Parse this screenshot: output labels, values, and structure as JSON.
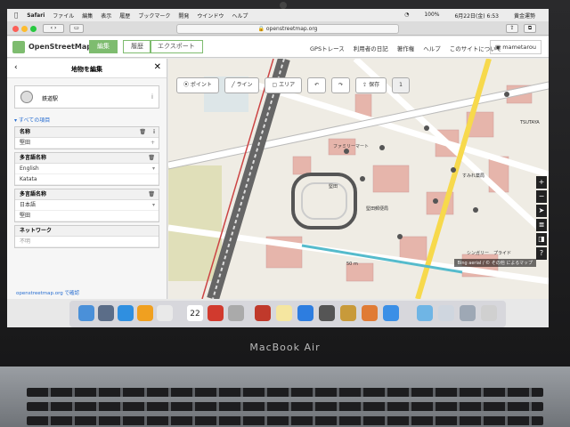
{
  "menubar": {
    "items": [
      "Safari",
      "ファイル",
      "編集",
      "表示",
      "履歴",
      "ブックマーク",
      "開発",
      "ウインドウ",
      "ヘルプ"
    ],
    "battery": "100%",
    "date": "6月22日(金) 6:53",
    "user": "黄金運勢"
  },
  "browser": {
    "url": "openstreetmap.org"
  },
  "osm": {
    "brand": "OpenStreetMap",
    "edit_label": "編集",
    "history_label": "履歴",
    "export_label": "エクスポート",
    "nav": [
      "GPSトレース",
      "利用者の日記",
      "著作権",
      "ヘルプ",
      "このサイトについて"
    ],
    "username": "mametarou"
  },
  "sidebar": {
    "title": "地物を編集",
    "preset_name": "鉄道駅",
    "all_fields": "すべての項目",
    "name_label": "名称",
    "name_value": "堅田",
    "multi_label": "多言語名称",
    "multi1_lang": "English",
    "multi1_value": "Katata",
    "multi2_lang": "日本語",
    "multi2_value": "堅田",
    "network_label": "ネットワーク",
    "network_value": "不明",
    "footer": "openstreetmap.org で確認"
  },
  "maptools": {
    "point": "ポイント",
    "line": "ライン",
    "area": "エリア",
    "save": "保存",
    "save_count": "1"
  },
  "map": {
    "attribution": "Bing aerial / © その他 によるマップ",
    "scale": "50 m",
    "labels": [
      "ファミリーマート",
      "堅田",
      "堅田郵便局",
      "TSUTAYA",
      "すみれ薬局",
      "シンガリー　プライド"
    ]
  },
  "dock": {
    "calendar_day": "22"
  },
  "laptop_label": "MacBook Air"
}
